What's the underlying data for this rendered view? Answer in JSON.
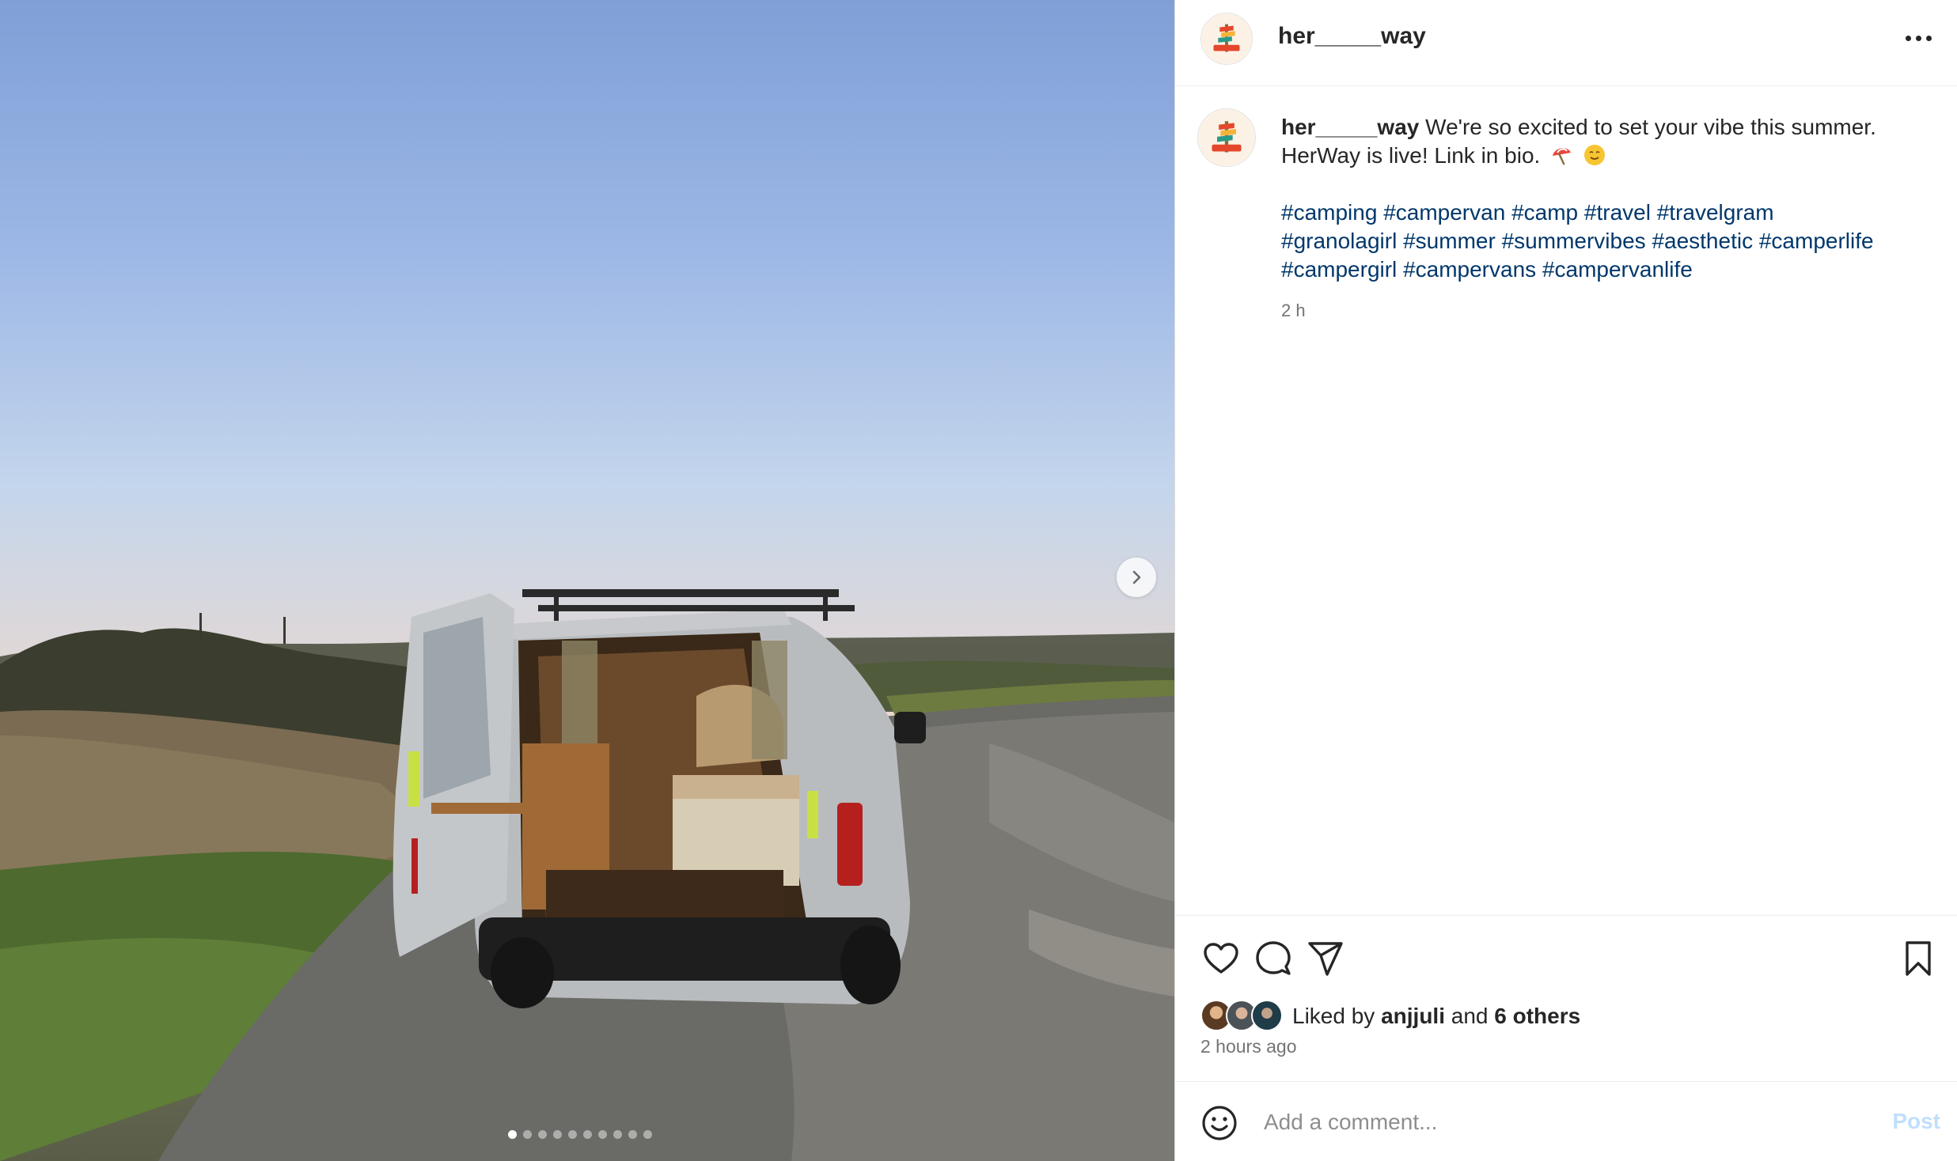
{
  "post": {
    "username": "her_____way",
    "image_alt": "Silver camper van with open rear doors on a gravel road at sunset",
    "carousel": {
      "total": 10,
      "current": 1
    }
  },
  "caption": {
    "username": "her_____way",
    "text": "We're so excited to set your vibe this summer. HerWay is live! Link in bio.",
    "emojis": [
      "beach-umbrella-emoji",
      "smiling-sun-emoji"
    ],
    "hashtags": [
      "#camping",
      "#campervan",
      "#camp",
      "#travel",
      "#travelgram",
      "#granolagirl",
      "#summer",
      "#summervibes",
      "#aesthetic",
      "#camperlife",
      "#campergirl",
      "#campervans",
      "#campervanlife"
    ],
    "time_ago": "2 h"
  },
  "actions": {
    "icons": [
      "heart-icon",
      "comment-icon",
      "share-icon",
      "bookmark-icon"
    ]
  },
  "likes": {
    "prefix": "Liked by",
    "first_liker": "anjjuli",
    "conjunction": "and",
    "others": "6 others"
  },
  "posted": "2 hours ago",
  "comment_box": {
    "placeholder": "Add a comment...",
    "post_label": "Post"
  },
  "colors": {
    "hashtag": "#00376b",
    "post_button_disabled": "#c0dffd",
    "muted_text": "#737373"
  }
}
